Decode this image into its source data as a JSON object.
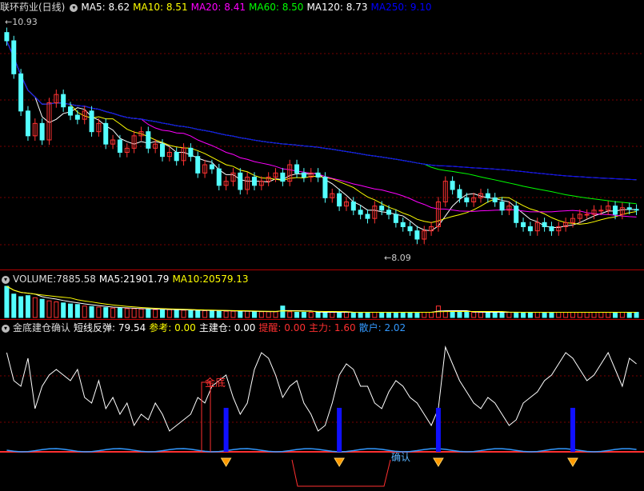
{
  "stock": {
    "name": "联环药业(日线)"
  },
  "ma": [
    {
      "label": "MA5:",
      "value": "8.62",
      "color": "#ffffff"
    },
    {
      "label": "MA10:",
      "value": "8.51",
      "color": "#ffff00"
    },
    {
      "label": "MA20:",
      "value": "8.41",
      "color": "#ff00ff"
    },
    {
      "label": "MA60:",
      "value": "8.50",
      "color": "#00ff00"
    },
    {
      "label": "MA120:",
      "value": "8.73",
      "color": "#ffffff"
    },
    {
      "label": "MA250:",
      "value": "9.10",
      "color": "#0000ff"
    }
  ],
  "price": {
    "high_label": "10.93",
    "low_label": "8.09"
  },
  "volume": {
    "label": "VOLUME:",
    "value": "7885.58",
    "ma5_label": "MA5:",
    "ma5": "21901.79",
    "ma10_label": "MA10:",
    "ma10": "20579.13"
  },
  "indicator": {
    "name": "金底建仓确认",
    "items": [
      {
        "label": "短线反弹:",
        "value": "79.54",
        "color": "#ffffff"
      },
      {
        "label": "参考:",
        "value": "0.00",
        "color": "#ffff00"
      },
      {
        "label": "主建仓:",
        "value": "0.00",
        "color": "#ffffff"
      },
      {
        "label": "提醒:",
        "value": "0.00",
        "color": "#ff3030"
      },
      {
        "label": "主力:",
        "value": "1.60",
        "color": "#ff3030"
      },
      {
        "label": "散户:",
        "value": "2.02",
        "color": "#3399ff"
      }
    ],
    "jindi_label": "金底",
    "confirm_label": "确认"
  },
  "colors": {
    "up": "#ff3232",
    "down": "#54ffff",
    "bg": "#000000",
    "grid": "#7a0000"
  },
  "chart_data": {
    "type": "line",
    "price_range": [
      8.0,
      11.0
    ],
    "close": [
      10.7,
      10.3,
      9.85,
      9.55,
      9.7,
      9.5,
      9.95,
      10.05,
      9.9,
      9.8,
      9.75,
      9.85,
      9.6,
      9.7,
      9.45,
      9.5,
      9.35,
      9.4,
      9.55,
      9.6,
      9.4,
      9.45,
      9.3,
      9.35,
      9.25,
      9.4,
      9.3,
      9.1,
      9.2,
      9.15,
      8.95,
      9.0,
      9.1,
      8.9,
      9.05,
      8.95,
      9.0,
      9.05,
      9.1,
      9.0,
      9.2,
      9.1,
      9.05,
      9.1,
      9.05,
      8.8,
      8.85,
      8.7,
      8.75,
      8.65,
      8.6,
      8.55,
      8.7,
      8.65,
      8.6,
      8.5,
      8.45,
      8.4,
      8.3,
      8.4,
      8.45,
      8.75,
      9.0,
      8.9,
      8.8,
      8.75,
      8.8,
      8.85,
      8.8,
      8.75,
      8.65,
      8.7,
      8.5,
      8.45,
      8.4,
      8.5,
      8.45,
      8.4,
      8.45,
      8.5,
      8.55,
      8.6,
      8.6,
      8.65,
      8.65,
      8.7,
      8.6,
      8.68,
      8.66,
      8.65
    ],
    "volume": [
      60000,
      45000,
      40000,
      42000,
      38000,
      35000,
      32000,
      30000,
      28000,
      26000,
      25000,
      22000,
      21000,
      20000,
      19000,
      18000,
      18000,
      17000,
      17000,
      16000,
      16000,
      15000,
      15000,
      15000,
      14000,
      14000,
      14000,
      13000,
      13000,
      13000,
      13000,
      12000,
      12000,
      12000,
      12000,
      11000,
      11000,
      11000,
      11000,
      22000,
      11000,
      10000,
      10000,
      10000,
      10000,
      10000,
      10000,
      10000,
      10000,
      10000,
      10000,
      10000,
      10000,
      10000,
      10000,
      10000,
      10000,
      10000,
      10000,
      10000,
      10000,
      22000,
      12000,
      11000,
      10000,
      10000,
      10000,
      10000,
      10000,
      10000,
      10000,
      10000,
      10000,
      10000,
      10000,
      10000,
      10000,
      10000,
      10000,
      10000,
      10000,
      10000,
      10000,
      10000,
      10000,
      10000,
      10000,
      10000,
      10000,
      10000
    ],
    "short_rebound": [
      85,
      60,
      55,
      80,
      35,
      55,
      65,
      70,
      65,
      60,
      70,
      45,
      40,
      60,
      35,
      45,
      30,
      40,
      20,
      30,
      25,
      40,
      30,
      15,
      20,
      25,
      30,
      45,
      40,
      55,
      60,
      65,
      45,
      30,
      40,
      70,
      85,
      80,
      65,
      45,
      55,
      60,
      40,
      30,
      15,
      20,
      40,
      65,
      75,
      70,
      55,
      55,
      40,
      35,
      50,
      60,
      55,
      45,
      40,
      30,
      20,
      35,
      90,
      75,
      60,
      50,
      40,
      35,
      45,
      40,
      30,
      20,
      25,
      40,
      45,
      50,
      60,
      65,
      75,
      85,
      80,
      70,
      60,
      65,
      75,
      85,
      70,
      55,
      80,
      75
    ],
    "gold_bottom_bars": [
      31,
      47,
      61,
      80
    ],
    "labels": [
      "金底",
      "确认"
    ]
  }
}
